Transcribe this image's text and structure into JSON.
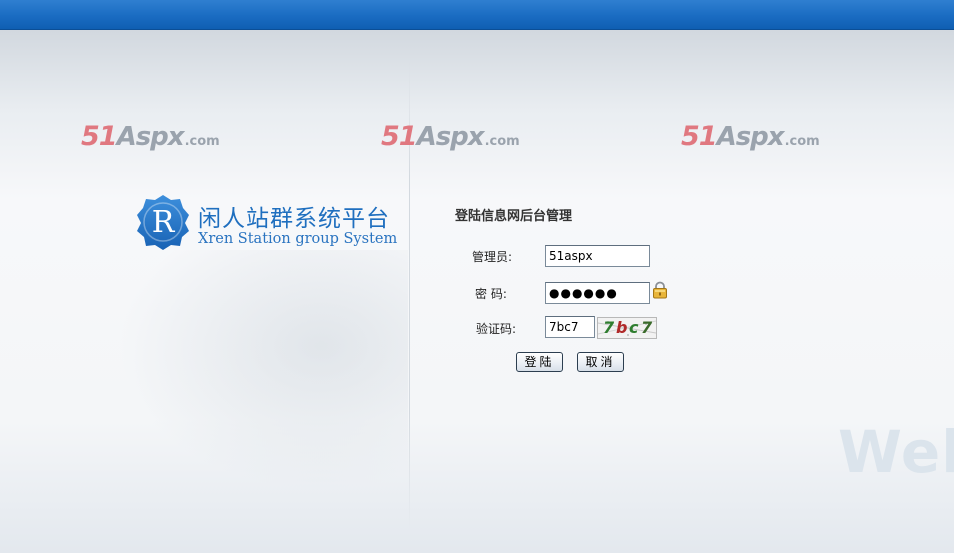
{
  "watermark": {
    "num": "51",
    "aspx": "Aspx",
    "com": ".com"
  },
  "brand": {
    "badge_letter": "R",
    "title": "闲人站群系统平台",
    "subtitle": "Xren Station group System"
  },
  "login": {
    "title": "登陆信息网后台管理",
    "username_label": "管理员:",
    "username_value": "51aspx",
    "password_label": "密 码:",
    "password_display": "●●●●●●",
    "captcha_label": "验证码:",
    "captcha_value": "7bc7",
    "captcha_image_text": [
      "7",
      "b",
      "c",
      "7"
    ],
    "login_button": "登陆",
    "cancel_button": "取消"
  },
  "background_text": "Welc",
  "colors": {
    "topbar": "#1a6cc2",
    "brand_blue": "#1f6fbf",
    "watermark_red": "#e07880",
    "watermark_gray": "#9aa3ad"
  },
  "icons": {
    "lock": "lock-icon",
    "badge": "brand-badge-icon"
  }
}
